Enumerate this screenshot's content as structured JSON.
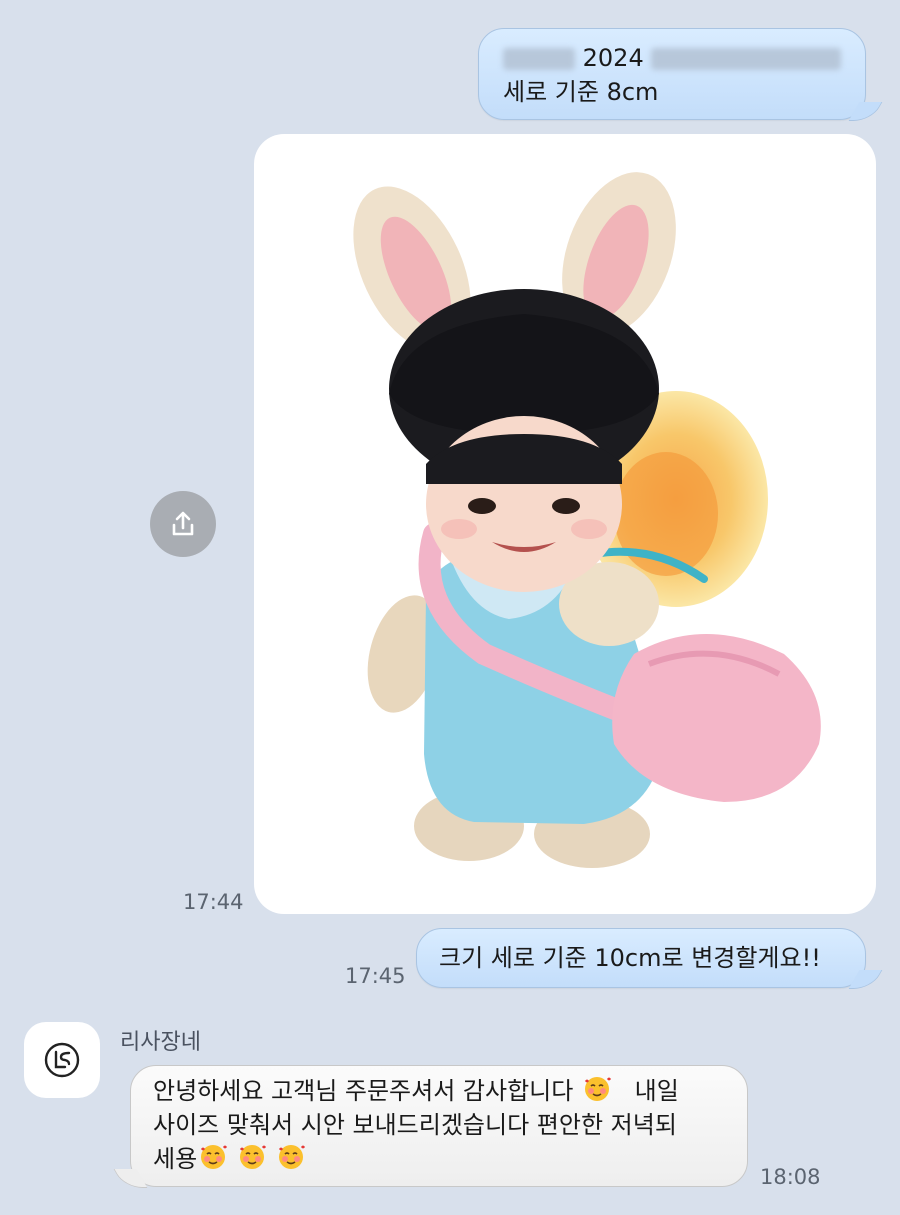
{
  "messages": {
    "msg1": {
      "year": "2024",
      "line2": "세로 기준 8cm"
    },
    "photo": {
      "time": "17:44"
    },
    "msg2": {
      "text": "크기 세로 기준 10cm로 변경할게요!!",
      "time": "17:45"
    },
    "reply": {
      "sender": "리사장네",
      "line1": "안녕하세요 고객님 주문주셔서 감사합니다",
      "line1_tail": "내일",
      "line2": "사이즈 맞춰서 시안 보내드리겠습니다 편안한 저녁되",
      "line3": "세용",
      "time": "18:08"
    }
  },
  "icons": {
    "share": "share-upload-icon",
    "avatar": "shop-logo-icon",
    "emoji": "smiling-face-with-hearts-emoji"
  },
  "colors": {
    "background": "#d8e0ec",
    "outgoing_bubble": "#c3ddfa",
    "incoming_bubble": "#eeeeee"
  }
}
